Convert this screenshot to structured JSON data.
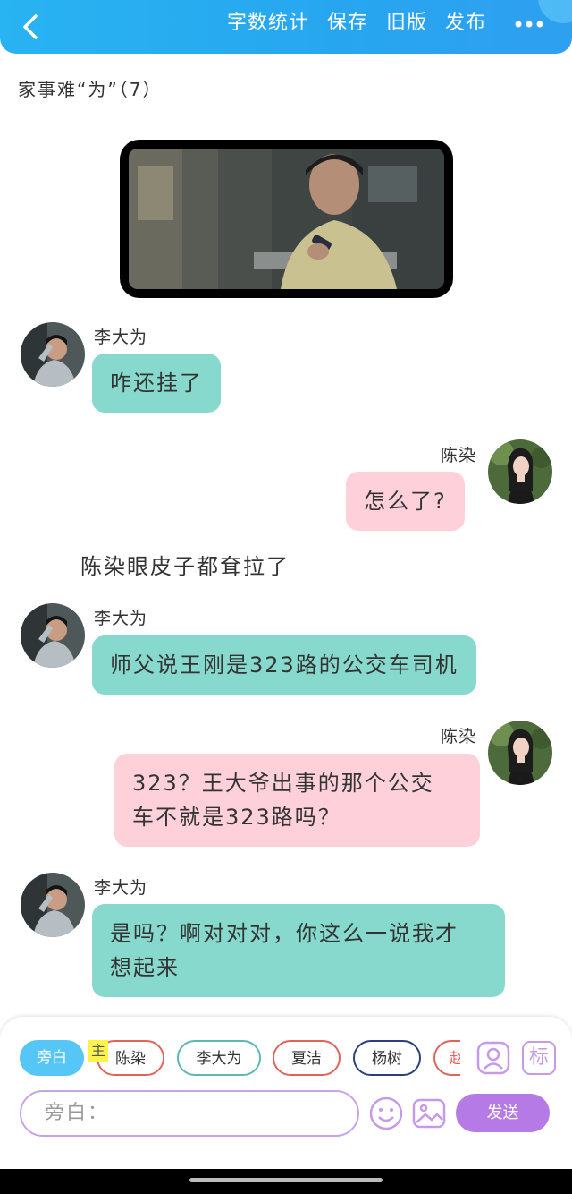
{
  "topbar": {
    "actions": [
      "字数统计",
      "保存",
      "旧版",
      "发布"
    ],
    "more_label": "•••"
  },
  "story": {
    "title": "家事难“为”（7）"
  },
  "messages": {
    "m1": {
      "speaker": "李大为",
      "text": "咋还挂了"
    },
    "m2": {
      "speaker": "陈染",
      "text": "怎么了?"
    },
    "narration": "陈染眼皮子都耷拉了",
    "m3": {
      "speaker": "李大为",
      "text": "师父说王刚是323路的公交车司机"
    },
    "m4": {
      "speaker": "陈染",
      "lines": [
        "323？王大爷出事的那个公交",
        "车不就是323路吗？"
      ]
    },
    "m5": {
      "speaker": "李大为",
      "lines": [
        "是吗？啊对对对，你这么一说我才",
        "想起来"
      ]
    }
  },
  "composer": {
    "roles": [
      "旁白",
      "陈染",
      "李大为",
      "夏洁",
      "杨树",
      "赵"
    ],
    "main_badge": "主",
    "tag_button": "标",
    "input_placeholder": "旁白：",
    "send_label": "发送"
  },
  "colors": {
    "topbar": "#28b3f2",
    "teal_bubble": "#87d9cd",
    "pink_bubble": "#fdd0da",
    "send_button": "#b67ae6",
    "aside_chip": "#55c6f5"
  }
}
